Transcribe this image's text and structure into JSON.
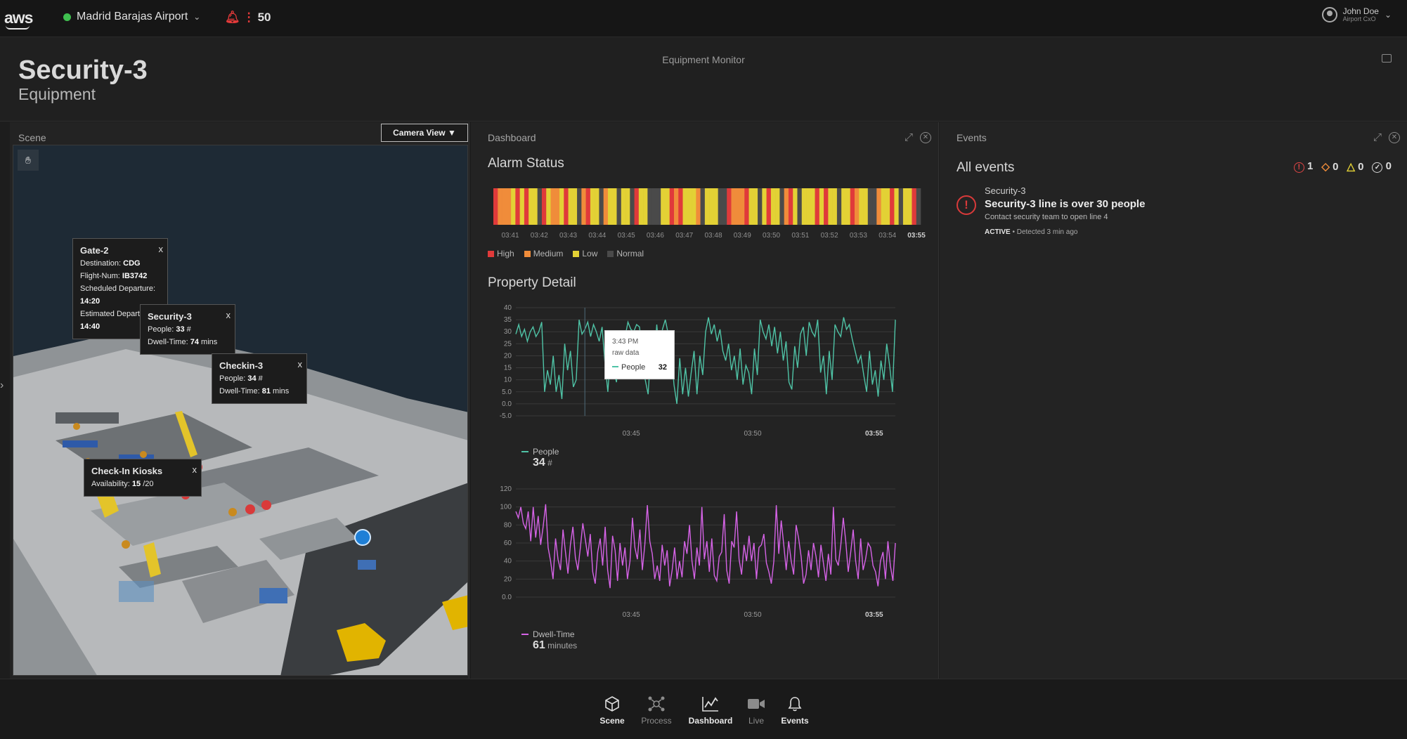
{
  "topbar": {
    "logo": "aws",
    "site": "Madrid Barajas Airport",
    "alarm_count": "50",
    "user_name": "John Doe",
    "user_role": "Airport CxO"
  },
  "header": {
    "title": "Security-3",
    "subtitle": "Equipment",
    "monitor_label": "Equipment Monitor"
  },
  "scene": {
    "label": "Scene",
    "camera_button": "Camera View ▼",
    "tooltips": [
      {
        "title": "Gate-2",
        "lines": [
          {
            "k": "Destination: ",
            "v": "CDG"
          },
          {
            "k": "Flight-Num: ",
            "v": "IB3742"
          },
          {
            "k": "Scheduled Departure: ",
            "v": "14:20"
          },
          {
            "k": "Estimated Departure: ",
            "v": "14:40"
          }
        ]
      },
      {
        "title": "Security-3",
        "lines": [
          {
            "k": "People: ",
            "v": "33",
            "u": " #"
          },
          {
            "k": "Dwell-Time: ",
            "v": "74",
            "u": " mins"
          }
        ]
      },
      {
        "title": "Checkin-3",
        "lines": [
          {
            "k": "People: ",
            "v": "34",
            "u": " #"
          },
          {
            "k": "Dwell-Time: ",
            "v": "81",
            "u": " mins"
          }
        ]
      },
      {
        "title": "Check-In Kiosks",
        "lines": [
          {
            "k": "Availability: ",
            "v": "15",
            "u": " /20"
          }
        ]
      }
    ],
    "close_label": "x"
  },
  "dashboard": {
    "label": "Dashboard",
    "alarm_title": "Alarm Status",
    "property_title": "Property Detail",
    "alarm_ticks": [
      "03:41",
      "03:42",
      "03:43",
      "03:44",
      "03:45",
      "03:46",
      "03:47",
      "03:48",
      "03:49",
      "03:50",
      "03:51",
      "03:52",
      "03:53",
      "03:54",
      "03:55"
    ],
    "alarm_legend": [
      {
        "label": "High",
        "color": "#e03a3a"
      },
      {
        "label": "Medium",
        "color": "#f08c3a"
      },
      {
        "label": "Low",
        "color": "#e3d135"
      },
      {
        "label": "Normal",
        "color": "#4a4a4a"
      }
    ],
    "alarm_sequence": [
      "H",
      "M",
      "M",
      "M",
      "L",
      "H",
      "L",
      "H",
      "L",
      "L",
      "N",
      "H",
      "L",
      "M",
      "M",
      "L",
      "H",
      "L",
      "L",
      "N",
      "M",
      "H",
      "L",
      "L",
      "N",
      "M",
      "L",
      "L",
      "N",
      "L",
      "L",
      "N",
      "H",
      "L",
      "L",
      "N",
      "N",
      "N",
      "L",
      "L",
      "H",
      "M",
      "H",
      "L",
      "L",
      "L",
      "M",
      "N",
      "L",
      "L",
      "L",
      "N",
      "N",
      "H",
      "M",
      "M",
      "M",
      "H",
      "L",
      "L",
      "N",
      "L",
      "H",
      "L",
      "L",
      "N",
      "M",
      "H",
      "L",
      "N",
      "L",
      "L",
      "L",
      "H",
      "L",
      "H",
      "L",
      "L",
      "N",
      "L",
      "L",
      "H",
      "M",
      "L",
      "L",
      "N",
      "N",
      "M",
      "L",
      "L",
      "H",
      "L",
      "N",
      "L",
      "L",
      "H",
      "N"
    ],
    "hover": {
      "time": "3:43 PM",
      "sub": "raw data",
      "series": "People",
      "value": "32"
    },
    "people": {
      "name": "People",
      "value": "34",
      "unit": "#",
      "color": "#4fc3a6"
    },
    "dwell": {
      "name": "Dwell-Time",
      "value": "61",
      "unit": "minutes",
      "color": "#d563e6"
    }
  },
  "chart_data": [
    {
      "type": "line",
      "title": "",
      "series": [
        {
          "name": "People",
          "values": [
            29,
            33,
            28,
            31,
            26,
            30,
            32,
            28,
            30,
            34,
            5,
            14,
            8,
            20,
            5,
            12,
            2,
            25,
            14,
            22,
            7,
            10,
            35,
            29,
            31,
            34,
            28,
            33,
            30,
            26,
            32,
            17,
            5,
            22,
            14,
            9,
            27,
            20,
            28,
            34,
            31,
            30,
            33,
            32,
            22,
            10,
            4,
            23,
            16,
            33,
            20,
            31,
            35,
            29,
            22,
            8,
            0,
            19,
            4,
            15,
            3,
            13,
            22,
            4,
            20,
            12,
            30,
            36,
            29,
            33,
            26,
            31,
            22,
            18,
            25,
            14,
            20,
            10,
            23,
            8,
            16,
            13,
            4,
            23,
            12,
            35,
            30,
            27,
            33,
            24,
            32,
            21,
            30,
            18,
            26,
            9,
            6,
            24,
            15,
            29,
            32,
            20,
            34,
            30,
            28,
            35,
            13,
            20,
            4,
            22,
            10,
            33,
            30,
            28,
            36,
            31,
            33,
            27,
            22,
            17,
            20,
            12,
            5,
            22,
            8,
            14,
            3,
            18,
            10,
            25,
            16,
            5,
            35
          ]
        }
      ],
      "x_ticks": [
        "03:45",
        "03:50",
        "03:55"
      ],
      "ylim": [
        -5,
        40
      ],
      "y_ticks": [
        "-5.0",
        "0.0",
        "5.0",
        "10",
        "15",
        "20",
        "25",
        "30",
        "35",
        "40"
      ]
    },
    {
      "type": "line",
      "title": "",
      "series": [
        {
          "name": "Dwell-Time",
          "values": [
            95,
            88,
            100,
            82,
            76,
            95,
            62,
            100,
            66,
            90,
            58,
            78,
            103,
            55,
            40,
            20,
            65,
            42,
            30,
            75,
            50,
            26,
            58,
            78,
            44,
            30,
            55,
            82,
            64,
            45,
            70,
            28,
            15,
            50,
            65,
            35,
            78,
            30,
            10,
            68,
            52,
            18,
            60,
            35,
            55,
            20,
            40,
            88,
            55,
            42,
            75,
            30,
            58,
            102,
            62,
            48,
            20,
            35,
            18,
            58,
            35,
            52,
            12,
            30,
            55,
            20,
            40,
            22,
            62,
            48,
            80,
            40,
            20,
            55,
            35,
            100,
            42,
            62,
            28,
            65,
            24,
            18,
            45,
            50,
            92,
            30,
            15,
            62,
            55,
            95,
            42,
            25,
            58,
            40,
            68,
            40,
            60,
            20,
            55,
            58,
            70,
            38,
            28,
            15,
            40,
            102,
            48,
            85,
            58,
            30,
            62,
            40,
            25,
            80,
            65,
            45,
            15,
            25,
            52,
            30,
            60,
            45,
            22,
            58,
            38,
            18,
            48,
            25,
            100,
            42,
            35,
            58,
            88,
            62,
            28,
            50,
            75,
            40,
            20,
            65,
            30,
            42,
            60,
            55,
            35,
            28,
            12,
            40,
            50,
            20,
            62,
            35,
            18,
            60
          ]
        }
      ],
      "x_ticks": [
        "03:45",
        "03:50",
        "03:55"
      ],
      "ylim": [
        0,
        120
      ],
      "y_ticks": [
        "0.0",
        "20",
        "40",
        "60",
        "80",
        "100",
        "120"
      ]
    }
  ],
  "events": {
    "label": "Events",
    "all_title": "All events",
    "filters": [
      {
        "icon": "!",
        "count": "1",
        "color": "#e04545"
      },
      {
        "icon": "◇",
        "count": "0",
        "color": "#f08c3a"
      },
      {
        "icon": "△",
        "count": "0",
        "color": "#e3d135"
      },
      {
        "icon": "✓",
        "count": "0",
        "color": "#d8d8d8"
      }
    ],
    "item": {
      "name": "Security-3",
      "title": "Security-3 line is over 30 people",
      "desc": "Contact security team to open line 4",
      "status": "ACTIVE",
      "time": "Detected 3 min ago"
    }
  },
  "bottom_nav": [
    {
      "label": "Scene",
      "active": true
    },
    {
      "label": "Process",
      "active": false
    },
    {
      "label": "Dashboard",
      "active": true
    },
    {
      "label": "Live",
      "active": false
    },
    {
      "label": "Events",
      "active": true
    }
  ]
}
